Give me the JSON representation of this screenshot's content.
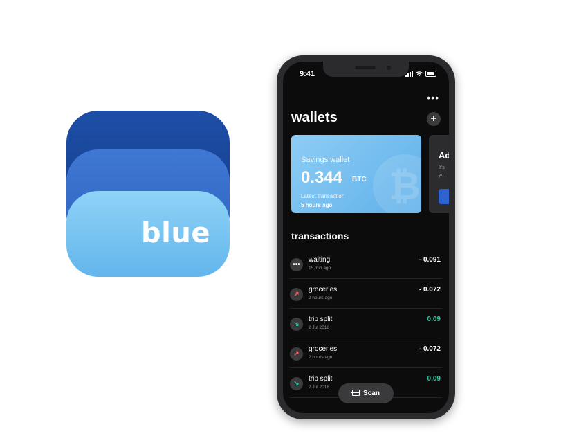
{
  "app_icon": {
    "wordmark": "blue",
    "colors": {
      "back": "#1d4fa8",
      "middle": "#3f78d4",
      "front": "#8fd3f7"
    }
  },
  "status_bar": {
    "time": "9:41",
    "icons": [
      "signal-icon",
      "wifi-icon",
      "battery-icon"
    ]
  },
  "header": {
    "title": "wallets",
    "more_label": "•••",
    "add_label": "+"
  },
  "wallet_card": {
    "label": "Savings wallet",
    "amount": "0.344",
    "unit": "BTC",
    "latest_label": "Latest transaction",
    "latest_time": "5 hours ago",
    "watermark": "₿",
    "colors": {
      "start": "#8dcdf5",
      "end": "#5fb0ea"
    }
  },
  "second_card": {
    "title": "Ad",
    "line1": "It's",
    "line2": "yo"
  },
  "transactions": {
    "title": "transactions",
    "items": [
      {
        "icon": "•••",
        "icon_name": "pending-icon",
        "name": "waiting",
        "time": "15 min ago",
        "amount": "- 0.091",
        "color": "#ffffff",
        "icon_color": "#ffffff"
      },
      {
        "icon": "↗",
        "icon_name": "outgoing-arrow-icon",
        "name": "groceries",
        "time": "2 hours ago",
        "amount": "- 0.072",
        "color": "#ffffff",
        "icon_color": "#f06a6a"
      },
      {
        "icon": "↘",
        "icon_name": "incoming-arrow-icon",
        "name": "trip split",
        "time": "2 Jul 2018",
        "amount": "0.09",
        "color": "#37c0a1",
        "icon_color": "#37c0a1"
      },
      {
        "icon": "↗",
        "icon_name": "outgoing-arrow-icon",
        "name": "groceries",
        "time": "2 hours ago",
        "amount": "- 0.072",
        "color": "#ffffff",
        "icon_color": "#f06a6a"
      },
      {
        "icon": "↘",
        "icon_name": "incoming-arrow-icon",
        "name": "trip split",
        "time": "2 Jul 2018",
        "amount": "0.09",
        "color": "#37c0a1",
        "icon_color": "#37c0a1"
      }
    ]
  },
  "scan_button": {
    "label": "Scan"
  }
}
